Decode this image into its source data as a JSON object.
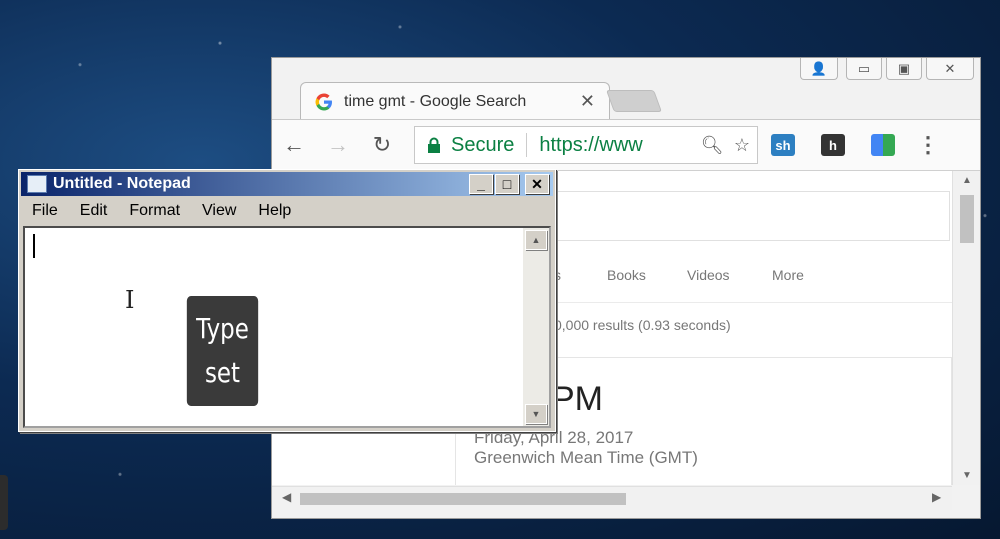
{
  "browser": {
    "tab_title": "time gmt - Google Search",
    "tab_close": "✕",
    "window_controls": {
      "user": "👤",
      "minimize": "▭",
      "maximize": "▣",
      "close": "✕"
    },
    "nav": {
      "back": "←",
      "forward": "→",
      "reload": "↻"
    },
    "address": {
      "secure_label": "Secure",
      "url": "https://www"
    },
    "extensions": {
      "sh": "sh",
      "h": "h"
    },
    "menu": "⋮"
  },
  "results_page": {
    "tabs": [
      "s",
      "Books",
      "Videos",
      "More"
    ],
    "result_stats": "0,000 results (0.93 seconds)",
    "time_value": "PM",
    "date": "Friday, April 28, 2017",
    "timezone": "Greenwich Mean Time (GMT)"
  },
  "notepad": {
    "title": "Untitled - Notepad",
    "menu": [
      "File",
      "Edit",
      "Format",
      "View",
      "Help"
    ],
    "buttons": {
      "minimize": "_",
      "maximize": "□",
      "close": "✕"
    },
    "cursor_glyph": "I"
  },
  "overlay": {
    "line1": "Type",
    "line2": "set"
  },
  "colors": {
    "secure_green": "#0b8043",
    "title_blue": "#0a246a"
  }
}
